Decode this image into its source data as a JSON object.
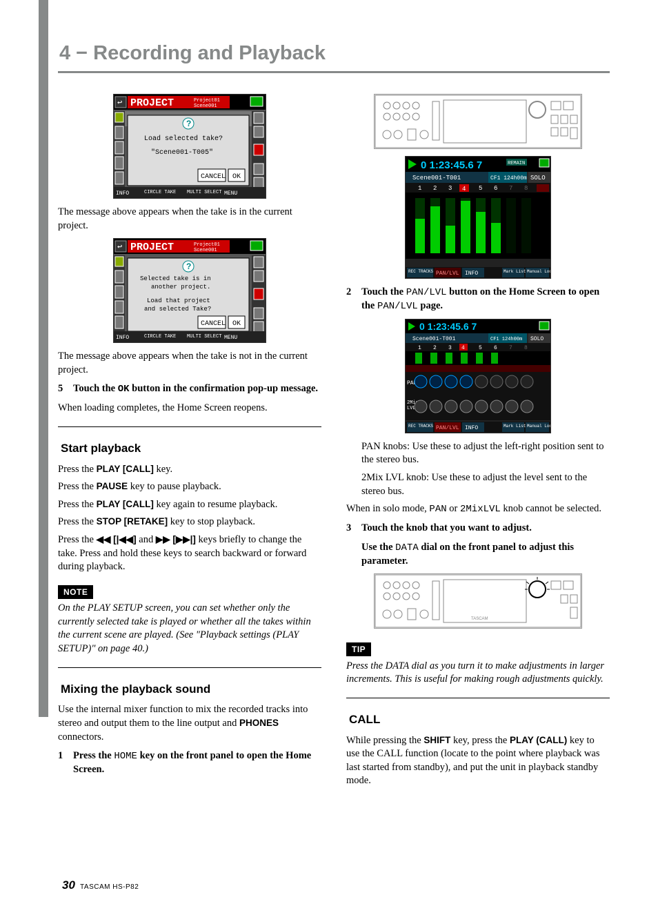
{
  "chapter": "4 − Recording and Playback",
  "left": {
    "fig1_caption": "The message above appears when the take is in the current project.",
    "fig2_caption": "The message above appears when the take is not in the current project.",
    "step5": {
      "num": "5",
      "text_a": "Touch the ",
      "ok": "OK",
      "text_b": " button in the confirmation pop-up message."
    },
    "loading_done": "When loading completes, the Home Screen reopens.",
    "h_start_playback": "Start playback",
    "sp1_a": "Press the ",
    "sp1_key": "PLAY [CALL]",
    "sp1_b": " key.",
    "sp2_a": "Press the ",
    "sp2_key": "PAUSE",
    "sp2_b": " key to pause playback.",
    "sp3_a": "Press the ",
    "sp3_key": "PLAY [CALL]",
    "sp3_b": " key again to resume playback.",
    "sp4_a": "Press the ",
    "sp4_key": "STOP [RETAKE]",
    "sp4_b": " key to stop playback.",
    "sp5_a": "Press the  ",
    "sp5_r1": "◀◀ [|◀◀]",
    "sp5_mid": " and ",
    "sp5_r2": "▶▶ [▶▶|]",
    "sp5_b": " keys briefly to change the take. Press and hold these keys to search backward or forward during playback.",
    "note_label": "NOTE",
    "note_text": "On the PLAY SETUP screen, you can set whether only the currently selected take is played or whether all the takes within the current scene are played. (See \"Playback settings (PLAY SETUP)\" on page 40.)",
    "h_mix": "Mixing the playback sound",
    "mix_intro_a": "Use the internal mixer function to mix the recorded tracks into stereo and output them to the line output and ",
    "mix_intro_key": "PHONES",
    "mix_intro_b": " connectors.",
    "step1": {
      "num": "1",
      "text_a": "Press the ",
      "home": "HOME",
      "text_b": " key on the front panel to open the Home Screen."
    },
    "ui1": {
      "title_a": "PROJECT",
      "title_b": "Project01",
      "title_c": "Scene001",
      "msg1": "Load selected take?",
      "msg2": "\"Scene001-T005\"",
      "cancel": "CANCEL",
      "ok": "OK",
      "info": "INFO",
      "circle": "CIRCLE TAKE",
      "multi": "MULTI SELECT",
      "menu": "MENU"
    },
    "ui2": {
      "title_a": "PROJECT",
      "title_b": "Project01",
      "title_c": "Scene001",
      "msg1": "Selected take is in another project.",
      "msg2": "Load that project and selected Take?",
      "cancel": "CANCEL",
      "ok": "OK",
      "info": "INFO",
      "circle": "CIRCLE TAKE",
      "multi": "MULTI SELECT",
      "menu": "MENU"
    }
  },
  "right": {
    "step2": {
      "num": "2",
      "a": "Touch the ",
      "pan": "PAN/LVL",
      "b": " button on the Home Screen to open the ",
      "pan2": "PAN/LVL",
      "c": " page."
    },
    "pan_line": "PAN knobs: Use these to adjust the left-right position sent to the stereo bus.",
    "lvl_line": "2Mix LVL knob: Use these to adjust the level sent to the stereo bus.",
    "solo_a": "When in solo mode, ",
    "solo_pan": "PAN",
    "solo_mid": " or ",
    "solo_mix": "2MixLVL",
    "solo_b": " knob cannot be selected.",
    "step3": {
      "num": "3",
      "line1": "Touch the knob that you want to adjust.",
      "line2_a": "Use the ",
      "data": "DATA",
      "line2_b": " dial on the front panel to adjust this parameter."
    },
    "tip_label": "TIP",
    "tip_text": "Press the DATA dial as you turn it to make adjustments in larger increments. This is useful for making rough adjustments quickly.",
    "h_call": "CALL",
    "call_a": "While pressing the ",
    "call_shift": "SHIFT",
    "call_b": " key, press the ",
    "call_play": "PLAY (CALL)",
    "call_c": " key to use the CALL function (locate to the point where playback was last started from standby), and put the unit in playback standby mode.",
    "home_ui": {
      "tc": "0 1:23:45.6 7",
      "remain": "REMAIN",
      "take": "Scene001-T001",
      "cf1": "CF1 124h00m",
      "solo": "SOLO",
      "nums": [
        "1",
        "2",
        "3",
        "4",
        "5",
        "6",
        "7",
        "8"
      ],
      "rec": "REC TRACKS",
      "panlvl": "PAN/LVL",
      "info": "INFO",
      "mark": "Mark List",
      "manual": "Manual Locate"
    }
  },
  "footer": {
    "page": "30",
    "model": "TASCAM  HS-P82"
  }
}
